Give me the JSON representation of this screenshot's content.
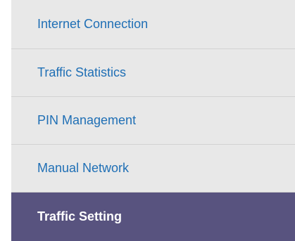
{
  "menu": {
    "items": [
      {
        "label": "Internet Connection",
        "active": false
      },
      {
        "label": "Traffic Statistics",
        "active": false
      },
      {
        "label": "PIN Management",
        "active": false
      },
      {
        "label": "Manual Network",
        "active": false
      },
      {
        "label": "Traffic Setting",
        "active": true
      }
    ]
  },
  "colors": {
    "menu_background": "#e8e8e8",
    "link_text": "#1f6fb5",
    "active_background": "#58537f",
    "active_text": "#ffffff"
  }
}
